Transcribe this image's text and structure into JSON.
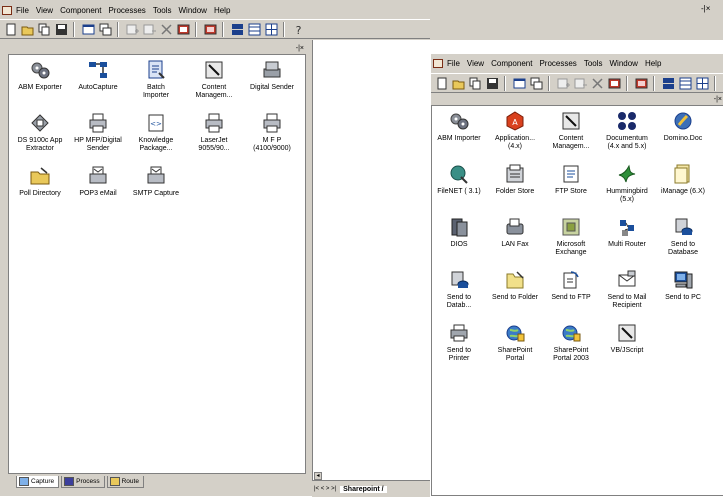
{
  "left_window": {
    "menu": [
      "File",
      "View",
      "Component",
      "Processes",
      "Tools",
      "Window",
      "Help"
    ],
    "window_controls": "-|×",
    "toolbar": [
      "new-icon",
      "open-icon",
      "copy-icon",
      "save-icon",
      "window-icon",
      "windows-icon",
      "add-icon",
      "remove-icon",
      "delete-icon",
      "properties-icon",
      "run-icon",
      "tile-horizontal-icon",
      "tile-vertical-icon",
      "tile-grid-icon",
      "help-icon"
    ],
    "panel_close": "-|×",
    "items": [
      {
        "label": "ABM Exporter",
        "icon": "gears-icon"
      },
      {
        "label": "AutoCapture",
        "icon": "network-icon"
      },
      {
        "label": "Batch\nImporter",
        "icon": "batch-doc-icon"
      },
      {
        "label": "Content\nManagem...",
        "icon": "pen-box-icon"
      },
      {
        "label": "Digital Sender",
        "icon": "digital-sender-icon"
      },
      {
        "label": "DS 9100c App\nExtractor",
        "icon": "extractor-icon"
      },
      {
        "label": "HP MFP/Digital\nSender",
        "icon": "printer-icon"
      },
      {
        "label": "Knowledge\nPackage...",
        "icon": "package-icon"
      },
      {
        "label": "LaserJet\n9055/90...",
        "icon": "printer-icon"
      },
      {
        "label": "M F P\n(4100/9000)",
        "icon": "printer-icon"
      },
      {
        "label": "Poll Directory",
        "icon": "folder-icon"
      },
      {
        "label": "POP3 eMail",
        "icon": "mail-printer-icon"
      },
      {
        "label": "SMTP Capture",
        "icon": "mail-printer-icon"
      }
    ],
    "tabs": [
      {
        "label": "Capture",
        "icon": "capture-tab-icon",
        "active": true
      },
      {
        "label": "Process",
        "icon": "process-tab-icon",
        "active": false
      },
      {
        "label": "Route",
        "icon": "route-tab-icon",
        "active": false
      }
    ],
    "sheet_tab": "Sharepoint /"
  },
  "right_window": {
    "menu": [
      "File",
      "View",
      "Component",
      "Processes",
      "Tools",
      "Window",
      "Help"
    ],
    "toolbar": [
      "new-icon",
      "open-icon",
      "copy-icon",
      "save-icon",
      "window-icon",
      "windows-icon",
      "add-icon",
      "remove-icon",
      "delete-icon",
      "properties-icon",
      "run-icon",
      "tile-horizontal-icon",
      "tile-vertical-icon",
      "tile-grid-icon"
    ],
    "panel_close": "-|×",
    "items": [
      {
        "label": "ABM Importer",
        "icon": "gears-icon"
      },
      {
        "label": "Application...\n(4.x)",
        "icon": "application-icon"
      },
      {
        "label": "Content\nManagem...",
        "icon": "pen-box-icon"
      },
      {
        "label": "Documentum\n(4.x and 5.x)",
        "icon": "documentum-icon"
      },
      {
        "label": "Domino.Doc",
        "icon": "domino-icon"
      },
      {
        "label": "FileNET ( 3.1)",
        "icon": "filenet-icon"
      },
      {
        "label": "Folder Store",
        "icon": "folder-store-icon"
      },
      {
        "label": "FTP Store",
        "icon": "ftp-icon"
      },
      {
        "label": "Hummingbird\n(5.x)",
        "icon": "hummingbird-icon"
      },
      {
        "label": "iManage (6.X)",
        "icon": "imanage-icon"
      },
      {
        "label": "DIOS",
        "icon": "dios-icon"
      },
      {
        "label": "LAN Fax",
        "icon": "fax-icon"
      },
      {
        "label": "Microsoft\nExchange",
        "icon": "exchange-icon"
      },
      {
        "label": "Multi Router",
        "icon": "router-icon"
      },
      {
        "label": "Send to\nDatabase",
        "icon": "database-icon"
      },
      {
        "label": "Send to\nDatab...",
        "icon": "database-icon"
      },
      {
        "label": "Send to Folder",
        "icon": "send-folder-icon"
      },
      {
        "label": "Send to FTP",
        "icon": "send-ftp-icon"
      },
      {
        "label": "Send to Mail\nRecipient",
        "icon": "send-mail-icon"
      },
      {
        "label": "Send to PC",
        "icon": "send-pc-icon"
      },
      {
        "label": "Send to\nPrinter",
        "icon": "send-printer-icon"
      },
      {
        "label": "SharePoint\nPortal",
        "icon": "sharepoint-icon"
      },
      {
        "label": "SharePoint\nPortal 2003",
        "icon": "sharepoint-icon"
      },
      {
        "label": "VB/JScript",
        "icon": "script-icon"
      }
    ]
  },
  "colors": {
    "chrome": "#d4d0c8",
    "title_accent": "#0a246a",
    "panel_bg": "#ffffff"
  }
}
